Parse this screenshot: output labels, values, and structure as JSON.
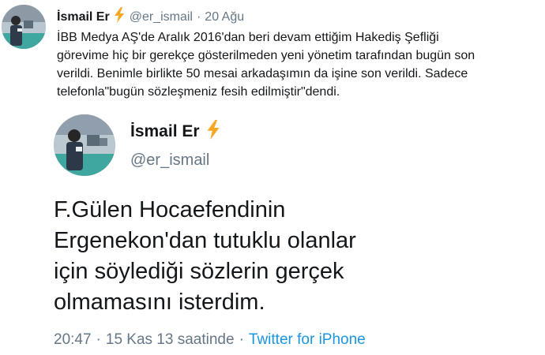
{
  "reply_tweet": {
    "display_name": "İsmail Er",
    "handle": "@er_ismail",
    "separator": "·",
    "date": "20 Ağu",
    "text": "İBB Medya AŞ'de Aralık 2016'dan beri devam ettiğim Hakediş Şefliği\ngörevime hiç bir gerekçe gösterilmeden yeni yönetim tarafından bugün son\nverildi. Benimle birlikte 50 mesai arkadaşımın da işine son verildi. Sadece\ntelefonla\"bugün sözleşmeniz fesih edilmiştir\"dendi.",
    "icons": [
      "avatar",
      "lightning-bolt-icon"
    ]
  },
  "quoted_tweet": {
    "display_name": "İsmail Er",
    "handle": "@er_ismail",
    "text": "F.Gülen Hocaefendinin\nErgenekon'dan tutuklu olanlar\niçin söylediği sözlerin gerçek\nolmamasını isterdim.",
    "time": "20:47",
    "dot": "·",
    "date": "15 Kas 13 saatinde",
    "source": "Twitter for iPhone",
    "icons": [
      "avatar",
      "lightning-bolt-icon"
    ]
  },
  "colors": {
    "text": "#14171a",
    "secondary": "#657786",
    "link": "#1b95e0",
    "bolt": "#f5a623"
  }
}
